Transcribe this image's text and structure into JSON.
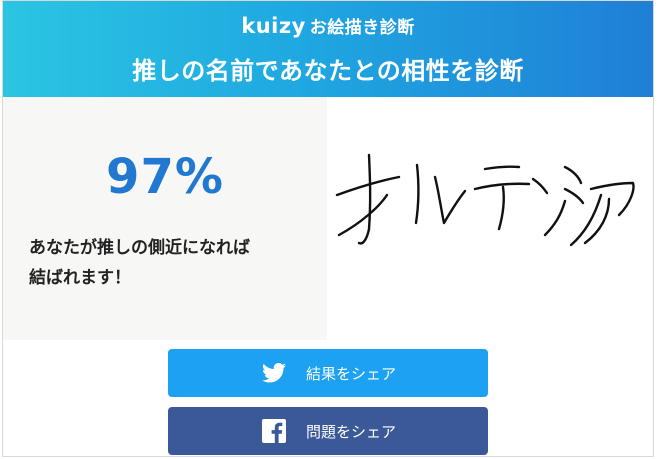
{
  "header": {
    "brand": "kuizy",
    "brand_sub": "お絵描き診断",
    "title": "推しの名前であなたとの相性を診断"
  },
  "result": {
    "percent": "97%",
    "message_line1": "あなたが推しの側近になれば",
    "message_line2": "結ばれます！"
  },
  "drawing": {
    "icon": "handwritten-drawing",
    "stroke_color": "#111111"
  },
  "buttons": {
    "share_result_label": "結果をシェア",
    "share_question_label": "問題をシェア"
  },
  "colors": {
    "percent": "#2178d0",
    "twitter": "#1da1f2",
    "facebook": "#3b5998"
  }
}
